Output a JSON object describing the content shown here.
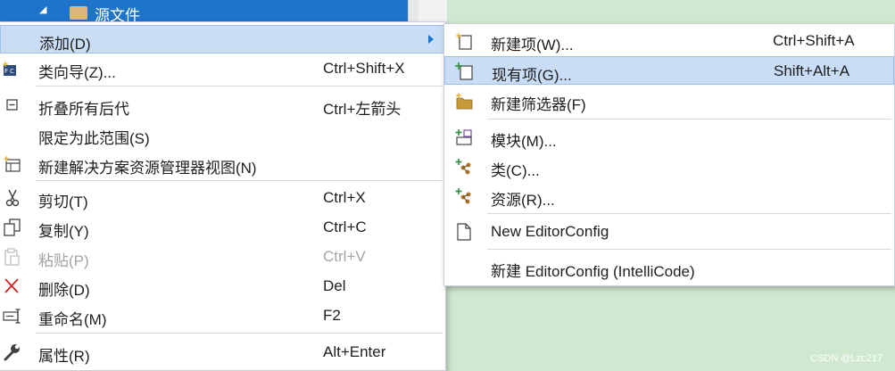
{
  "background": {
    "selected_node_label": "源文件",
    "expand_arrow": "◢"
  },
  "main_menu": {
    "items": [
      {
        "label": "添加(D)",
        "shortcut": "",
        "icon": "none",
        "has_submenu": true,
        "highlighted": true
      },
      {
        "label": "类向导(Z)...",
        "shortcut": "Ctrl+Shift+X",
        "icon": "class-wizard-icon"
      },
      {
        "label": "折叠所有后代",
        "shortcut": "Ctrl+左箭头",
        "icon": "collapse-icon"
      },
      {
        "label": "限定为此范围(S)",
        "shortcut": "",
        "icon": "none"
      },
      {
        "label": "新建解决方案资源管理器视图(N)",
        "shortcut": "",
        "icon": "new-view-icon"
      },
      {
        "label": "剪切(T)",
        "shortcut": "Ctrl+X",
        "icon": "scissors-icon"
      },
      {
        "label": "复制(Y)",
        "shortcut": "Ctrl+C",
        "icon": "copy-icon"
      },
      {
        "label": "粘贴(P)",
        "shortcut": "Ctrl+V",
        "icon": "paste-icon",
        "disabled": true
      },
      {
        "label": "删除(D)",
        "shortcut": "Del",
        "icon": "delete-icon"
      },
      {
        "label": "重命名(M)",
        "shortcut": "F2",
        "icon": "rename-icon"
      },
      {
        "label": "属性(R)",
        "shortcut": "Alt+Enter",
        "icon": "wrench-icon"
      }
    ]
  },
  "sub_menu": {
    "items": [
      {
        "label": "新建项(W)...",
        "shortcut": "Ctrl+Shift+A",
        "icon": "new-item-icon"
      },
      {
        "label": "现有项(G)...",
        "shortcut": "Shift+Alt+A",
        "icon": "existing-item-icon",
        "highlighted": true
      },
      {
        "label": "新建筛选器(F)",
        "shortcut": "",
        "icon": "new-filter-icon"
      },
      {
        "label": "模块(M)...",
        "shortcut": "",
        "icon": "module-icon"
      },
      {
        "label": "类(C)...",
        "shortcut": "",
        "icon": "class-icon"
      },
      {
        "label": "资源(R)...",
        "shortcut": "",
        "icon": "resource-icon"
      },
      {
        "label": "New EditorConfig",
        "shortcut": "",
        "icon": "editorconfig-file-icon"
      },
      {
        "label": "新建 EditorConfig (IntelliCode)",
        "shortcut": "",
        "icon": "none"
      }
    ]
  },
  "watermark": "CSDN @Lzc217",
  "colors": {
    "accent": "#1e74c9",
    "highlight": "#c9ddf6",
    "highlight_border": "#99c1ee",
    "disabled_text": "#a2a4a5",
    "background_green": "#cfe8cf"
  }
}
